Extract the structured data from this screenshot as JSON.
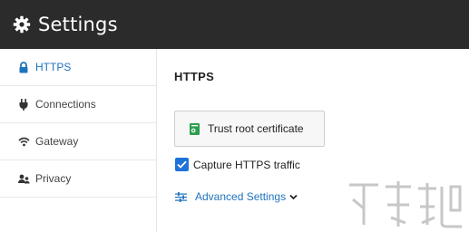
{
  "header": {
    "title": "Settings",
    "icon": "gear-icon"
  },
  "sidebar": {
    "items": [
      {
        "label": "HTTPS",
        "icon": "lock-icon",
        "active": true
      },
      {
        "label": "Connections",
        "icon": "plug-icon",
        "active": false
      },
      {
        "label": "Gateway",
        "icon": "wifi-icon",
        "active": false
      },
      {
        "label": "Privacy",
        "icon": "users-icon",
        "active": false
      }
    ]
  },
  "main": {
    "section_title": "HTTPS",
    "trust_button_label": "Trust root certificate",
    "capture_label": "Capture HTTPS traffic",
    "capture_checked": true,
    "advanced_label": "Advanced Settings"
  },
  "colors": {
    "header_bg": "#2b2b2b",
    "accent": "#1e73be",
    "checkbox": "#1e73d8",
    "cert_icon": "#2e9e4f"
  }
}
